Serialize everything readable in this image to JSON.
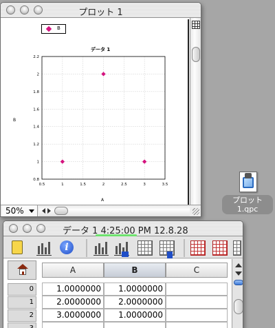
{
  "plot_window": {
    "title": "プロット 1",
    "zoom": "50%",
    "legend_label": "B",
    "chart_data": {
      "type": "scatter",
      "title": "データ 1",
      "xlabel": "A",
      "ylabel": "B",
      "xlim": [
        0.5,
        3.5
      ],
      "ylim": [
        0.8,
        2.2
      ],
      "x_ticks": [
        "0.5",
        "1",
        "1.5",
        "2",
        "2.5",
        "3",
        "3.5"
      ],
      "y_ticks": [
        "0.8",
        "1",
        "1.2",
        "1.4",
        "1.6",
        "1.8",
        "2",
        "2.2"
      ],
      "grid": true,
      "legend": "top-left",
      "series": [
        {
          "name": "B",
          "color": "#d4147f",
          "marker": "diamond",
          "x": [
            1,
            2,
            3
          ],
          "y": [
            1,
            2,
            1
          ]
        }
      ]
    }
  },
  "desktop_icon": {
    "label_line1": "プロット",
    "label_line2": "1.qpc"
  },
  "data_window": {
    "title": "データ 1 4:25:00 PM 12.8.28",
    "columns": [
      "A",
      "B",
      "C"
    ],
    "rows": [
      {
        "index": "0",
        "A": "1.0000000",
        "B": "1.0000000",
        "C": ""
      },
      {
        "index": "1",
        "A": "2.0000000",
        "B": "2.0000000",
        "C": ""
      },
      {
        "index": "2",
        "A": "3.0000000",
        "B": "1.0000000",
        "C": ""
      },
      {
        "index": "3",
        "A": "",
        "B": "",
        "C": ""
      }
    ]
  }
}
